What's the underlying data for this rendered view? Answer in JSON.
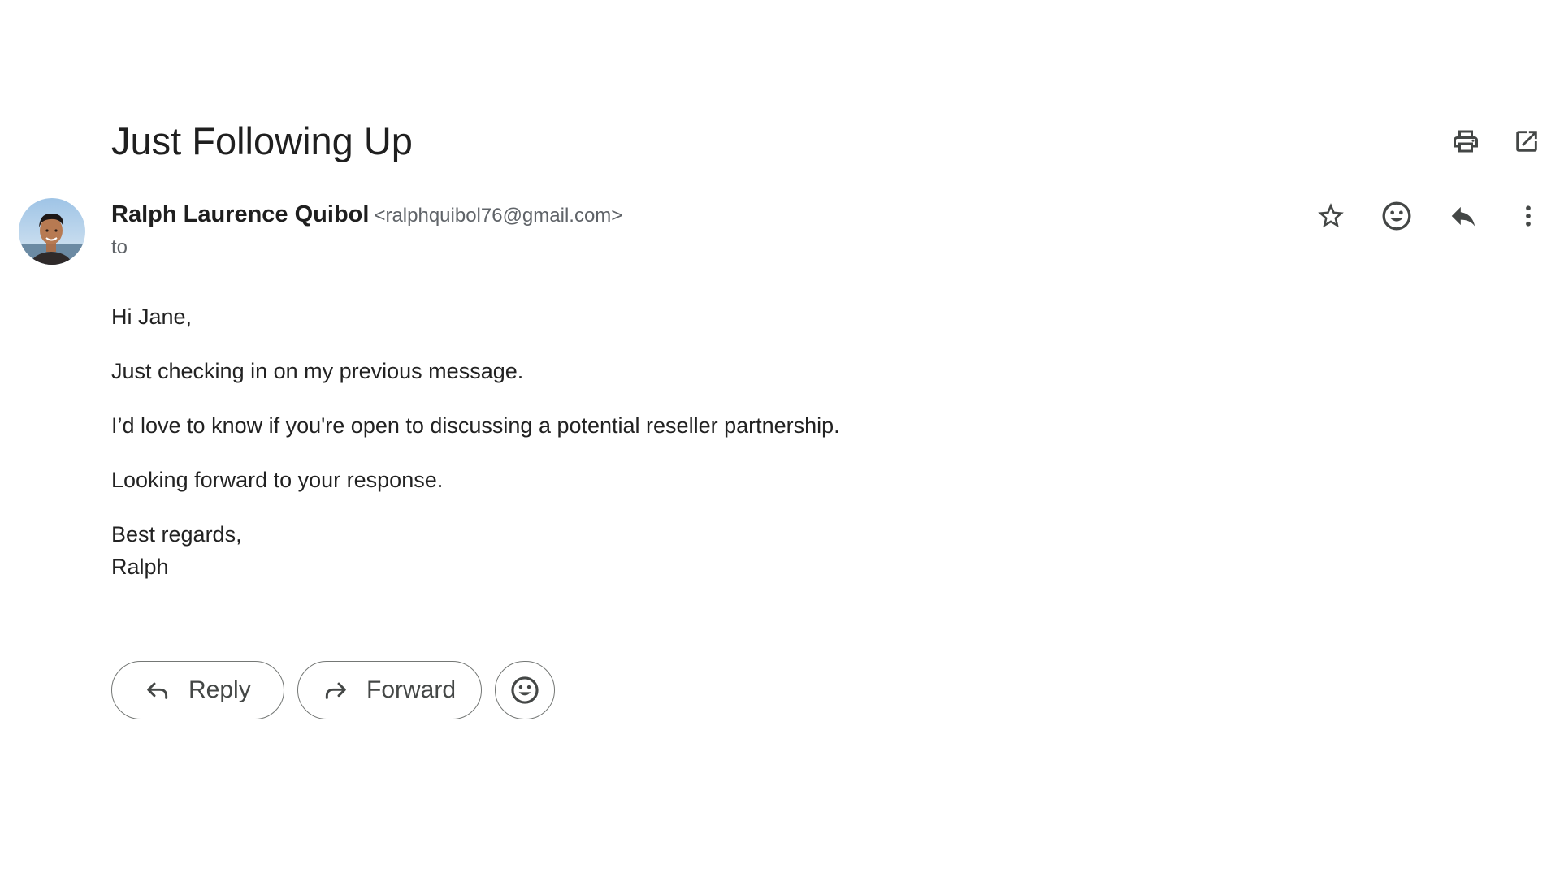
{
  "email": {
    "subject": "Just Following Up",
    "sender": {
      "name": "Ralph Laurence Quibol",
      "email": "<ralphquibol76@gmail.com>"
    },
    "to_label": "to",
    "body": {
      "greeting": "Hi Jane,",
      "line1": "Just checking in on my previous message.",
      "line2": "I’d love to know if you're open to discussing a potential reseller partnership.",
      "line3": "Looking forward to your response.",
      "closing": "Best regards,",
      "signature": "Ralph"
    }
  },
  "actions": {
    "reply_label": "Reply",
    "forward_label": "Forward"
  },
  "icons": {
    "print": "print-icon",
    "open_new_window": "open-in-new-window-icon",
    "star": "star-icon",
    "emoji_react": "emoji-icon",
    "reply": "reply-icon",
    "more": "more-vert-icon"
  },
  "colors": {
    "text": "#1f1f1f",
    "secondary_text": "#5f6368",
    "icon": "#444746",
    "pill_border": "#747775"
  }
}
